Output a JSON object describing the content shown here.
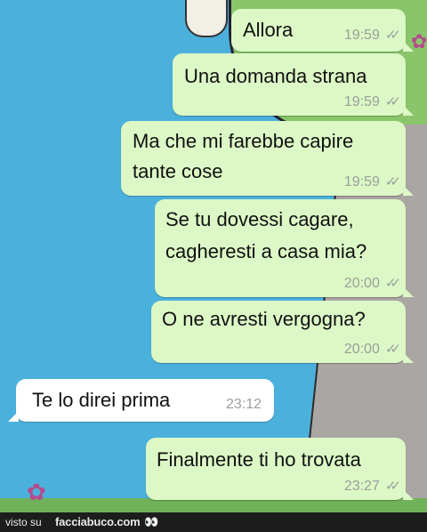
{
  "messages": [
    {
      "direction": "out",
      "text_lines": [
        "Allora"
      ],
      "time": "19:59"
    },
    {
      "direction": "out",
      "text_lines": [
        "Una domanda strana"
      ],
      "time": "19:59"
    },
    {
      "direction": "out",
      "text_lines": [
        "Ma che mi farebbe capire",
        "tante cose"
      ],
      "time": "19:59"
    },
    {
      "direction": "out",
      "text_lines": [
        "Se tu dovessi cagare,",
        "cagheresti a casa mia?"
      ],
      "time": "20:00"
    },
    {
      "direction": "out",
      "text_lines": [
        "O ne avresti vergogna?"
      ],
      "time": "20:00"
    },
    {
      "direction": "in",
      "text_lines": [
        "Te lo direi prima"
      ],
      "time": "23:12"
    },
    {
      "direction": "out",
      "text_lines": [
        "Finalmente ti ho trovata"
      ],
      "time": "23:27"
    }
  ],
  "read_receipt_icon": "double-check-icon",
  "footer": {
    "visto": "visto su",
    "brand": "facciabuco.com"
  },
  "colors": {
    "outgoing_bubble": "#dcf8c6",
    "incoming_bubble": "#ffffff",
    "timestamp": "#9aa09a",
    "wallpaper": "#4bb1dc"
  }
}
